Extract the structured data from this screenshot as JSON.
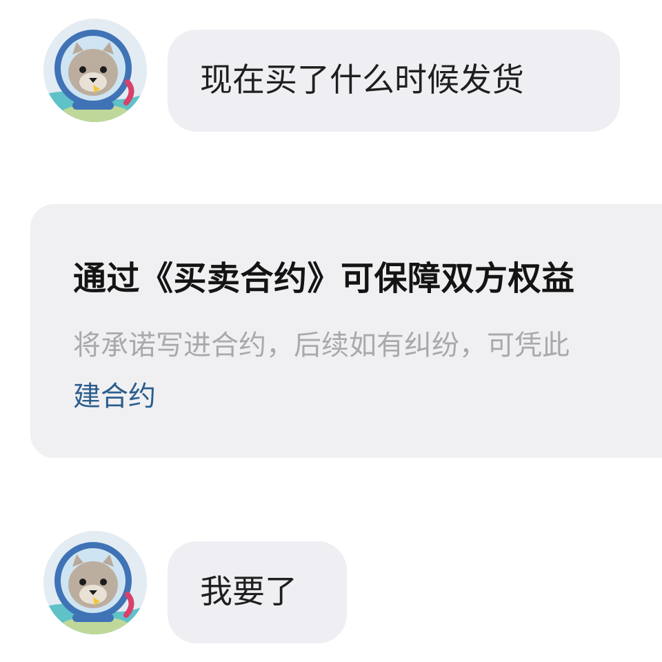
{
  "messages": [
    {
      "sender_avatar": "seal-astronaut-avatar",
      "text": "现在买了什么时候发货"
    },
    {
      "sender_avatar": "seal-astronaut-avatar",
      "text": "我要了"
    }
  ],
  "contract_notice": {
    "title": "通过《买卖合约》可保障双方权益",
    "description": "将承诺写进合约，后续如有纠纷，可凭此",
    "link_label": "建合约"
  },
  "colors": {
    "bubble_bg": "#efeff3",
    "notice_bg": "#f0f0f3",
    "link": "#2b5e8c",
    "muted_text": "#a9a9ad"
  }
}
